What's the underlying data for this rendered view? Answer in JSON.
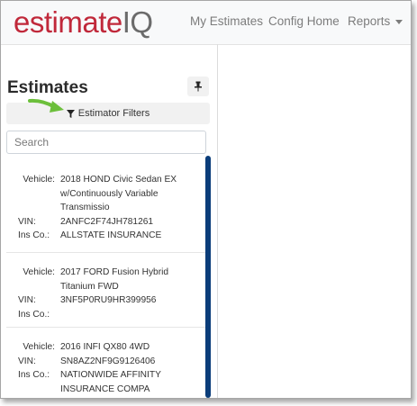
{
  "brand": {
    "name": "estimate",
    "suffix": "IQ"
  },
  "nav": {
    "my_estimates": "My Estimates",
    "config_home": "Config Home",
    "reports": "Reports"
  },
  "panel": {
    "title": "Estimates",
    "filter_label": "Estimator Filters",
    "search_placeholder": "Search"
  },
  "labels": {
    "vehicle": "Vehicle:",
    "vin": "VIN:",
    "ins": "Ins Co.:"
  },
  "estimates": [
    {
      "vehicle": "2018 HOND Civic Sedan EX w/Continuously Variable Transmissio",
      "vin": "2ANFC2F74JH781261",
      "ins": "ALLSTATE INSURANCE"
    },
    {
      "vehicle": "2017 FORD Fusion Hybrid Titanium FWD",
      "vin": "3NF5P0RU9HR399956",
      "ins": ""
    },
    {
      "vehicle": "2016 INFI QX80 4WD",
      "vin": "SN8AZ2NF9G9126406",
      "ins": "NATIONWIDE AFFINITY INSURANCE COMPA"
    }
  ],
  "colors": {
    "brand_red": "#c0283a",
    "scroll_blue": "#0b3d7a",
    "arrow_green": "#6cbf3b"
  },
  "icons": [
    "pin-icon",
    "filter-icon",
    "green-arrow-icon",
    "caret-down-icon"
  ]
}
